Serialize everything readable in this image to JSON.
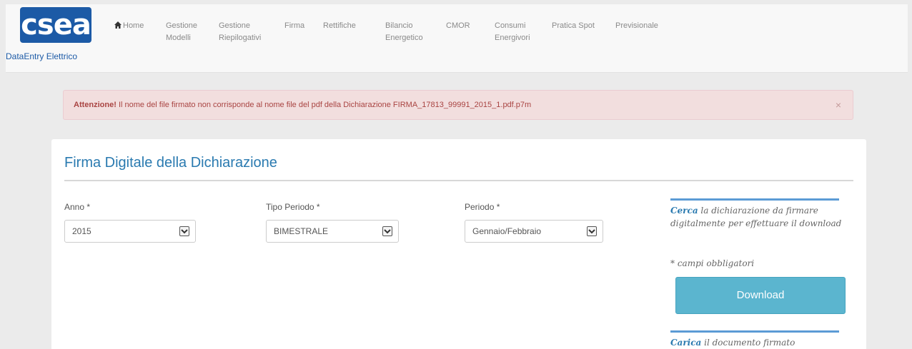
{
  "logo": {
    "mark": "csea",
    "subtitle": "DataEntry Elettrico"
  },
  "nav": {
    "items": [
      {
        "label": "Home",
        "icon": "home-icon"
      },
      {
        "label": "Gestione\nModelli"
      },
      {
        "label": "Gestione\nRiepilogativi"
      },
      {
        "label": "Firma"
      },
      {
        "label": "Rettifiche"
      },
      {
        "label": "Bilancio\nEnergetico"
      },
      {
        "label": "CMOR"
      },
      {
        "label": "Consumi\nEnergivori"
      },
      {
        "label": "Pratica Spot"
      },
      {
        "label": "Previsionale"
      }
    ]
  },
  "alert": {
    "strong": "Attenzione!",
    "message": " Il nome del file firmato non corrisponde al nome file del pdf della Dichiarazione FIRMA_17813_99991_2015_1.pdf.p7m",
    "close": "×"
  },
  "panel": {
    "title": "Firma Digitale della Dichiarazione",
    "fields": {
      "anno": {
        "label": "Anno *",
        "value": "2015"
      },
      "tipo_periodo": {
        "label": "Tipo Periodo *",
        "value": "BIMESTRALE"
      },
      "periodo": {
        "label": "Periodo *",
        "value": "Gennaio/Febbraio"
      }
    },
    "sidebar": {
      "cerca_strong": "Cerca",
      "cerca_text": " la dichiarazione da firmare digitalmente per effettuare il download",
      "required_note": "* campi obbligatori",
      "download_label": "Download",
      "carica_strong": "Carica",
      "carica_text": " il documento firmato digitalmente"
    }
  },
  "colors": {
    "brand": "#1c5aa6",
    "alert_bg": "#f2dede",
    "alert_text": "#a94442",
    "button": "#5bb5cf",
    "title": "#2a7ab0"
  }
}
